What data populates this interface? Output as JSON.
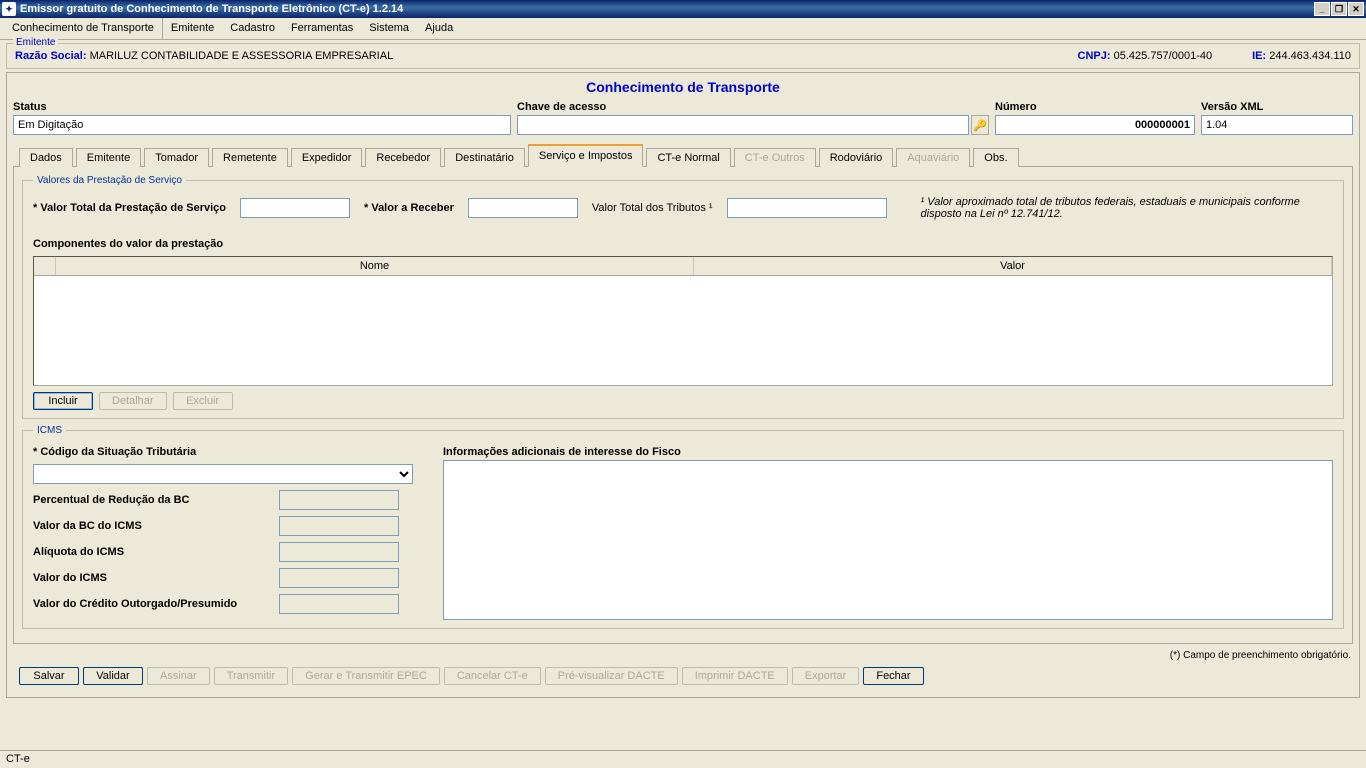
{
  "titlebar": {
    "title": "Emissor gratuito de Conhecimento de Transporte Eletrônico (CT-e) 1.2.14"
  },
  "menu": [
    "Conhecimento de Transporte",
    "Emitente",
    "Cadastro",
    "Ferramentas",
    "Sistema",
    "Ajuda"
  ],
  "emitente": {
    "legend": "Emitente",
    "razao_label": "Razão Social:",
    "razao_value": "MARILUZ CONTABILIDADE E ASSESSORIA EMPRESARIAL",
    "cnpj_label": "CNPJ:",
    "cnpj_value": "05.425.757/0001-40",
    "ie_label": "IE:",
    "ie_value": "244.463.434.110"
  },
  "main_title": "Conhecimento de Transporte",
  "status": {
    "status_label": "Status",
    "status_value": "Em Digitação",
    "chave_label": "Chave de acesso",
    "chave_value": "",
    "numero_label": "Número",
    "numero_value": "000000001",
    "versao_label": "Versão XML",
    "versao_value": "1.04"
  },
  "tabs": [
    {
      "label": "Dados",
      "active": false
    },
    {
      "label": "Emitente",
      "active": false
    },
    {
      "label": "Tomador",
      "active": false
    },
    {
      "label": "Remetente",
      "active": false
    },
    {
      "label": "Expedidor",
      "active": false
    },
    {
      "label": "Recebedor",
      "active": false
    },
    {
      "label": "Destinatário",
      "active": false
    },
    {
      "label": "Serviço e Impostos",
      "active": true
    },
    {
      "label": "CT-e Normal",
      "active": false
    },
    {
      "label": "CT-e Outros",
      "active": false,
      "disabled": true
    },
    {
      "label": "Rodoviário",
      "active": false
    },
    {
      "label": "Aquaviário",
      "active": false,
      "disabled": true
    },
    {
      "label": "Obs.",
      "active": false
    }
  ],
  "valores_group": {
    "legend": "Valores da Prestação de Serviço",
    "total_label": "* Valor Total da Prestação de Serviço",
    "receber_label": "* Valor a Receber",
    "tributos_label": "Valor Total dos Tributos ¹",
    "note": "¹ Valor aproximado total de tributos federais, estaduais e municipais conforme disposto na Lei nº 12.741/12.",
    "componentes_label": "Componentes do valor da prestação",
    "col_nome": "Nome",
    "col_valor": "Valor",
    "btn_incluir": "Incluir",
    "btn_detalhar": "Detalhar",
    "btn_excluir": "Excluir"
  },
  "icms": {
    "legend": "ICMS",
    "cst_label": "* Código da Situação Tributária",
    "perc_label": "Percentual de Redução da BC",
    "bc_label": "Valor da BC do ICMS",
    "aliq_label": "Alíquota do ICMS",
    "valor_label": "Valor do ICMS",
    "credito_label": "Valor do Crédito Outorgado/Presumido",
    "info_label": "Informações adicionais de interesse do Fisco"
  },
  "footer_note": "(*) Campo de preenchimento obrigatório.",
  "buttons": {
    "salvar": "Salvar",
    "validar": "Validar",
    "assinar": "Assinar",
    "transmitir": "Transmitir",
    "gerar_epec": "Gerar e Transmitir EPEC",
    "cancelar": "Cancelar CT-e",
    "previsualizar": "Pré-visualizar DACTE",
    "imprimir": "Imprimir DACTE",
    "exportar": "Exportar",
    "fechar": "Fechar"
  },
  "statusbar": "CT-e"
}
